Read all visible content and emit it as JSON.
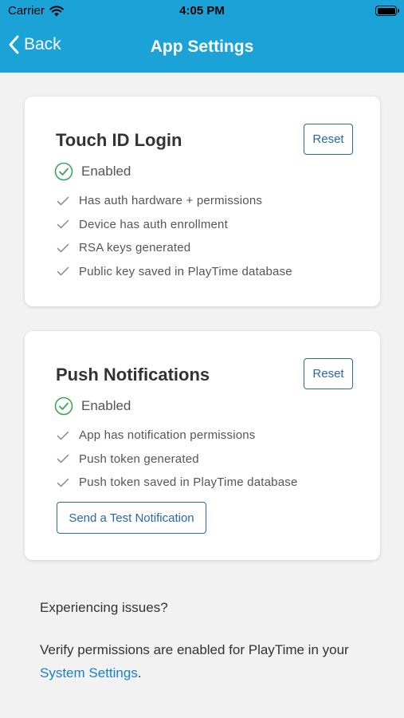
{
  "status_bar": {
    "carrier": "Carrier",
    "time": "4:05 PM"
  },
  "nav": {
    "back_label": "Back",
    "title": "App Settings"
  },
  "touch_id": {
    "title": "Touch ID Login",
    "reset_label": "Reset",
    "status": "Enabled",
    "checks": [
      "Has auth hardware + permissions",
      "Device has auth enrollment",
      "RSA keys generated",
      "Public key saved in PlayTime database"
    ]
  },
  "push": {
    "title": "Push Notifications",
    "reset_label": "Reset",
    "status": "Enabled",
    "checks": [
      "App has notification permissions",
      "Push token generated",
      "Push token saved in PlayTime database"
    ],
    "test_button": "Send a Test Notification"
  },
  "footer": {
    "question": "Experiencing issues?",
    "desc_prefix": "Verify permissions are enabled for PlayTime in your",
    "link": "System Settings",
    "desc_suffix": "."
  },
  "colors": {
    "header": "#1ba3d8",
    "accent": "#2a68a8",
    "success": "#3aa655",
    "link": "#1b7fc4"
  }
}
